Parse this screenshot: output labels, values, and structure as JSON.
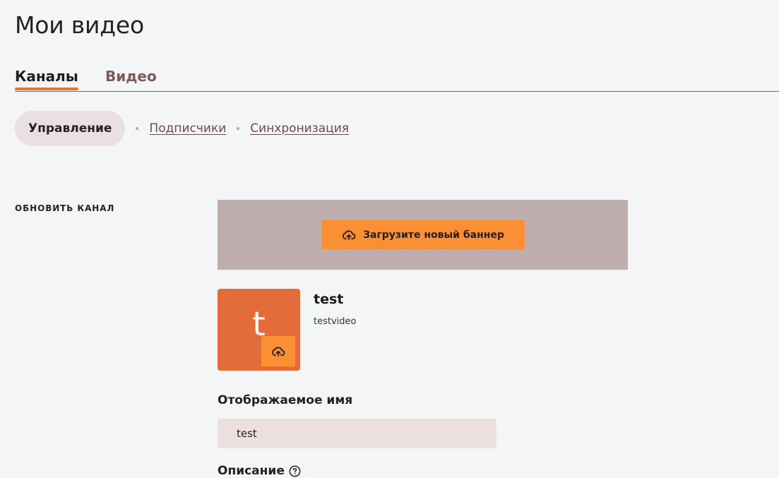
{
  "page": {
    "title": "Мои видео"
  },
  "tabs": [
    {
      "label": "Каналы",
      "active": true
    },
    {
      "label": "Видео",
      "active": false
    }
  ],
  "subnav": {
    "items": [
      {
        "label": "Управление",
        "active": true
      },
      {
        "label": "Подписчики",
        "active": false
      },
      {
        "label": "Синхронизация",
        "active": false
      }
    ]
  },
  "section": {
    "label": "ОБНОВИТЬ КАНАЛ"
  },
  "banner": {
    "upload_label": "Загрузите новый баннер",
    "icon": "cloud-upload-icon"
  },
  "channel": {
    "avatar_letter": "t",
    "name": "test",
    "handle": "testvideo",
    "avatar_upload_icon": "cloud-upload-icon"
  },
  "fields": {
    "display_name": {
      "label": "Отображаемое имя",
      "value": "test"
    },
    "description": {
      "label": "Описание",
      "help_icon": "question-circle-icon"
    }
  },
  "colors": {
    "accent": "#fb8f33",
    "avatar_background": "#e46b3b",
    "banner_background": "#bfaeae"
  }
}
